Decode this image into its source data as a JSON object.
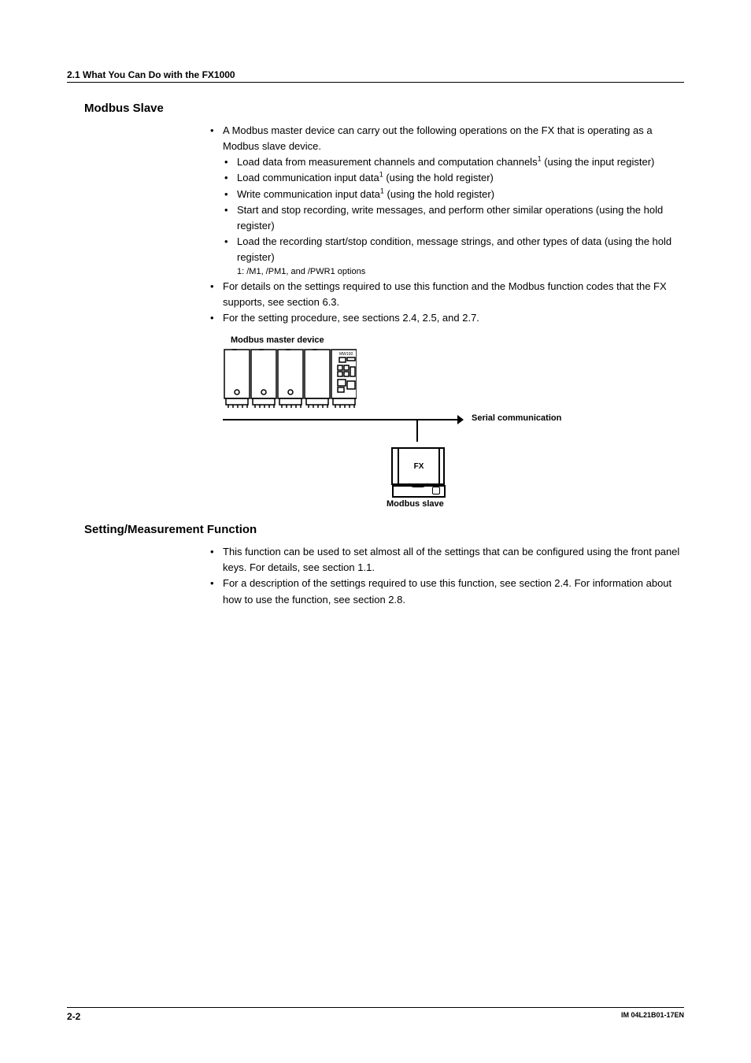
{
  "header": {
    "section": "2.1  What You Can Do with the FX1000"
  },
  "modbus": {
    "title": "Modbus Slave",
    "b1": "A Modbus master device can carry out the following operations on the FX that is operating as a Modbus slave device.",
    "s1a": "Load data from measurement channels and computation channels",
    "s1b": " (using the input register)",
    "s2a": "Load communication input data",
    "s2b": " (using the hold register)",
    "s3a": "Write communication input data",
    "s3b": " (using the hold register)",
    "s4": "Start and stop recording, write messages, and perform other similar operations (using the hold register)",
    "s5": "Load the recording start/stop condition, message strings, and other types of data (using the hold register)",
    "fn": "1:  /M1, /PM1, and /PWR1 options",
    "b2": "For details on the settings required to use this function and the Modbus function codes that the FX supports, see section 6.3.",
    "b3": "For the setting procedure, see sections 2.4, 2.5, and 2.7."
  },
  "diagram": {
    "master": "Modbus master device",
    "serial": "Serial communication",
    "fx": "FX",
    "slave": "Modbus slave",
    "chip": "MW100"
  },
  "setting": {
    "title": "Setting/Measurement Function",
    "b1": "This function can be used to set almost all of the settings that can be configured using the front panel keys. For details, see section 1.1.",
    "b2": "For a description of the settings required to use this function, see section 2.4. For information about how to use the function, see section 2.8."
  },
  "footer": {
    "page": "2-2",
    "doc": "IM 04L21B01-17EN"
  }
}
